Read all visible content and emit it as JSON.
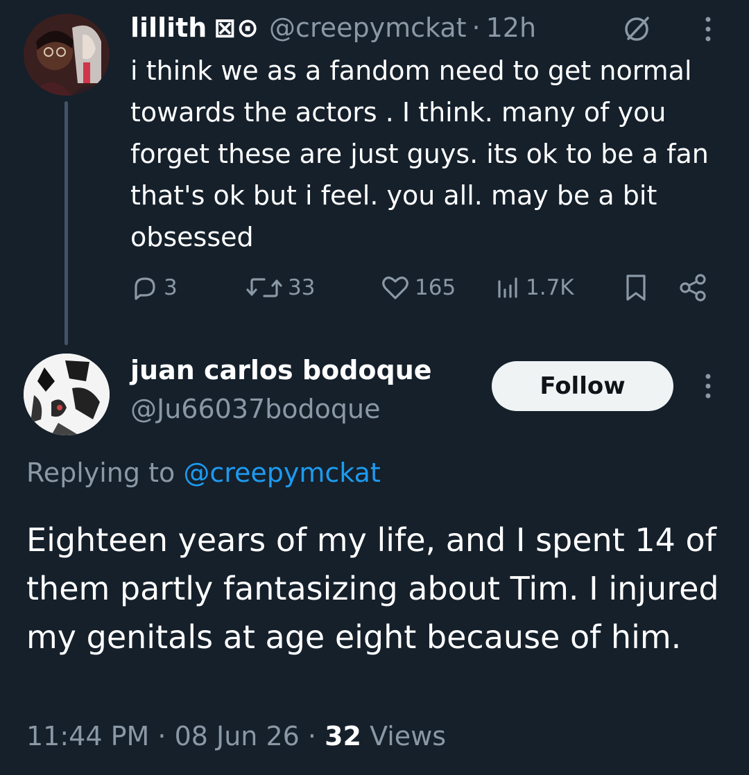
{
  "parent_tweet": {
    "name": "lillith",
    "name_emoji": "⊠⊙",
    "handle": "@creepymckat",
    "separator": "·",
    "time": "12h",
    "text": "i think we as a fandom need to get normal towards the actors . I think. many of you forget these are just guys. its ok to be a fan that's ok but i feel. you all. may be a bit obsessed",
    "actions": {
      "replies": "3",
      "retweets": "33",
      "likes": "165",
      "views": "1.7K"
    },
    "icons": [
      "grok-icon",
      "more-icon",
      "reply-icon",
      "retweet-icon",
      "like-icon",
      "views-icon",
      "bookmark-icon",
      "share-icon"
    ]
  },
  "reply_tweet": {
    "name": "juan carlos bodoque",
    "handle": "@Ju66037bodoque",
    "follow_label": "Follow",
    "replying_prefix": "Replying to",
    "replying_handle": "@creepymckat",
    "text": "Eighteen years of my life, and I spent 14 of them partly fantasizing about Tim. I injured my genitals at age eight because of him.",
    "time": "11:44 PM",
    "date": "08 Jun 26",
    "sep": "·",
    "views_count": "32",
    "views_label": "Views"
  },
  "colors": {
    "background": "#15202b",
    "text_primary": "#ffffff",
    "text_secondary": "#8b98a5",
    "link": "#1d9bf0",
    "follow_bg": "#eff3f4"
  }
}
